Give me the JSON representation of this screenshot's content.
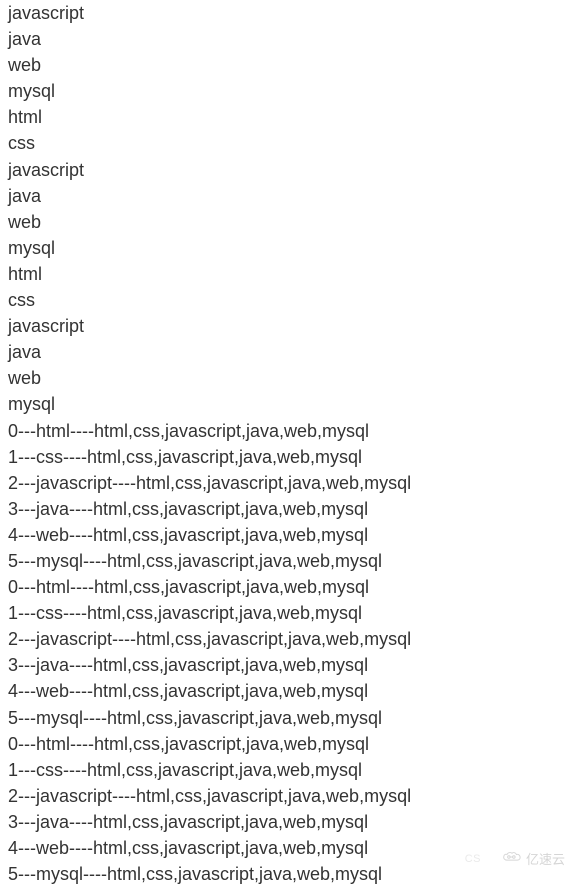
{
  "simple_lines": [
    "javascript",
    "java",
    "web",
    "mysql",
    "html",
    "css",
    "javascript",
    "java",
    "web",
    "mysql",
    "html",
    "css",
    "javascript",
    "java",
    "web",
    "mysql"
  ],
  "composite_lines": [
    "0---html----html,css,javascript,java,web,mysql",
    "1---css----html,css,javascript,java,web,mysql",
    "2---javascript----html,css,javascript,java,web,mysql",
    "3---java----html,css,javascript,java,web,mysql",
    "4---web----html,css,javascript,java,web,mysql",
    "5---mysql----html,css,javascript,java,web,mysql",
    "0---html----html,css,javascript,java,web,mysql",
    "1---css----html,css,javascript,java,web,mysql",
    "2---javascript----html,css,javascript,java,web,mysql",
    "3---java----html,css,javascript,java,web,mysql",
    "4---web----html,css,javascript,java,web,mysql",
    "5---mysql----html,css,javascript,java,web,mysql",
    "0---html----html,css,javascript,java,web,mysql",
    "1---css----html,css,javascript,java,web,mysql",
    "2---javascript----html,css,javascript,java,web,mysql",
    "3---java----html,css,javascript,java,web,mysql",
    "4---web----html,css,javascript,java,web,mysql",
    "5---mysql----html,css,javascript,java,web,mysql"
  ],
  "watermark": {
    "text": "亿速云",
    "csdn": "CS"
  }
}
